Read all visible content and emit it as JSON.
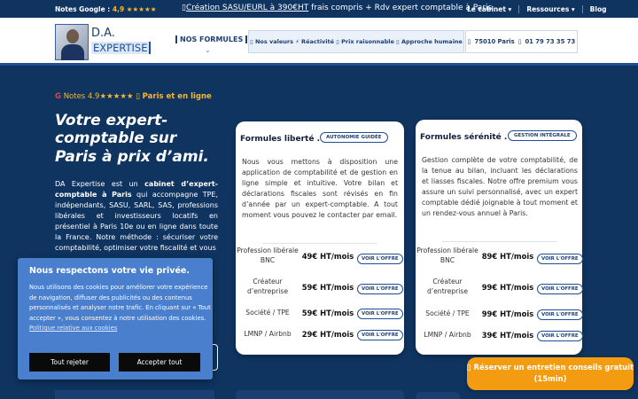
{
  "topbar": {
    "notes_label": "Notes Google :",
    "notes_rating": "4,9 ★★★★★",
    "promo_link": "Création SASU/EURL à 390€HT",
    "promo_rest": " frais compris + Rdv expert comptable à Paris",
    "nav": [
      "Le cabinet ▾",
      "Ressources ▾",
      "Blog"
    ]
  },
  "header": {
    "logo_line1": "D.A.",
    "logo_line2": "EXPERTISE",
    "formules": "NOS FORMULES",
    "values": [
      "Nos valeurs",
      "⚡ Réactivité",
      "Prix raisonnable",
      "Approche humaine"
    ],
    "address": "75010 Paris",
    "phone": "01 79 73 35 73"
  },
  "hero": {
    "rating_g": "G",
    "rating": "Notes 4.9★★★★★",
    "location": "Paris et en ligne",
    "title": "Votre expert-comptable sur Paris à prix d’ami.",
    "text_intro": "DA Expertise est un ",
    "text_bold": "cabinet d’expert-comptable à Paris",
    "text_rest": " qui accompagne TPE, indépendants, SASU, SARL, SAS, professions libérales et investisseurs locatifs en présentiel à Paris 10e ou en ligne dans toute la France. Notre méthode : sécuriser votre comptabilité, optimiser votre fiscalité et vous"
  },
  "cards": [
    {
      "title": "Formules liberté .",
      "badge": "AUTONOMIE GUIDÉE",
      "desc": "Nous vous mettons à disposition une application de comptabilité et de gestion en ligne simple et intuitive. Votre bilan et déclarations fiscales sont révisés en fin d’année par un expert-comptable. A tout moment vous pouvez le contacter par email.",
      "rows": [
        {
          "label": "Profession libérale BNC",
          "price": "49€ HT/mois",
          "button": "VOIR L'OFFRE"
        },
        {
          "label": "Créateur d’entreprise",
          "price": "59€ HT/mois",
          "button": "VOIR L'OFFRE"
        },
        {
          "label": "Société / TPE",
          "price": "59€ HT/mois",
          "button": "VOIR L'OFFRE"
        },
        {
          "label": "LMNP / Airbnb",
          "price": "29€ HT/mois",
          "button": "VOIR L'OFFRE"
        }
      ]
    },
    {
      "title": "Formules sérénité .",
      "badge": "GESTION INTÉGRALE",
      "desc": "Gestion complète de votre comptabilité, de la tenue au bilan, incluant les déclarations et liasses fiscales. Notre offre premium vous assure un suivi personnalisé, avec un expert comptable dédié joignable à tout moment et un rendez-vous annuel à Paris.",
      "rows": [
        {
          "label": "Profession libérale BNC",
          "price": "89€ HT/mois",
          "button": "VOIR L'OFFRE"
        },
        {
          "label": "Créateur d’entreprise",
          "price": "99€ HT/mois",
          "button": "VOIR L'OFFRE"
        },
        {
          "label": "Société / TPE",
          "price": "99€ HT/mois",
          "button": "VOIR L'OFFRE"
        },
        {
          "label": "LMNP / Airbnb",
          "price": "39€ HT/mois",
          "button": "VOIR L'OFFRE"
        }
      ]
    }
  ],
  "cookie": {
    "title": "Nous respectons votre vie privée.",
    "text": "Nous utilisons des cookies pour améliorer votre expérience de navigation, diffuser des publicités ou des contenus personnalisés et analyser notre trafic. En cliquant sur « Tout accepter », vous consentez à notre utilisation des cookies.",
    "policy": "Politique relative aux cookies",
    "reject": "Tout rejeter",
    "accept": "Accepter tout"
  },
  "cta": {
    "label": "Réserver un entretien conseils gratuit (15min)"
  }
}
